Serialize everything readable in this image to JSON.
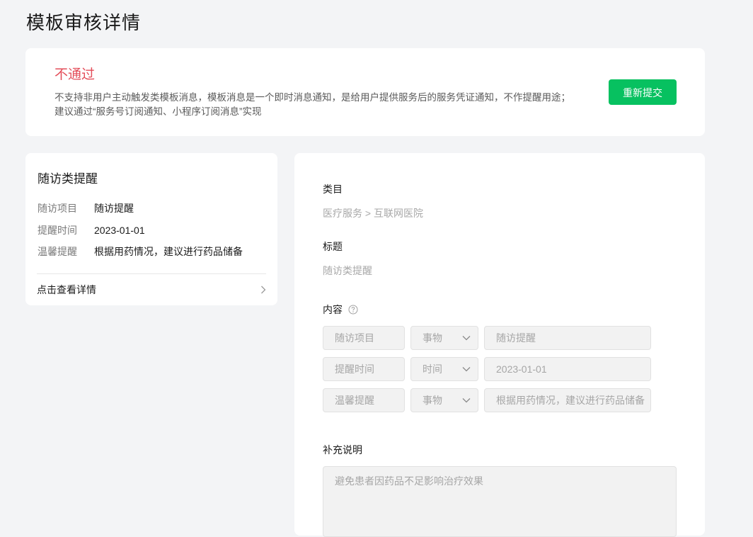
{
  "page": {
    "title": "模板审核详情"
  },
  "status": {
    "label": "不通过",
    "description": "不支持非用户主动触发类模板消息，模板消息是一个即时消息通知，是给用户提供服务后的服务凭证通知，不作提醒用途；建议通过“服务号订阅通知、小程序订阅消息”实现",
    "resubmit_label": "重新提交",
    "colors": {
      "reject": "#e34d59",
      "primary": "#07c160"
    }
  },
  "preview": {
    "title": "随访类提醒",
    "rows": [
      {
        "key": "随访项目",
        "value": "随访提醒"
      },
      {
        "key": "提醒时间",
        "value": "2023-01-01"
      },
      {
        "key": "温馨提醒",
        "value": "根据用药情况，建议进行药品储备"
      }
    ],
    "detail_link": "点击查看详情"
  },
  "form": {
    "category": {
      "label": "类目",
      "value": "医疗服务 > 互联网医院"
    },
    "title": {
      "label": "标题",
      "value": "随访类提醒"
    },
    "content": {
      "label": "内容",
      "rows": [
        {
          "key": "随访项目",
          "type": "事物",
          "value": "随访提醒"
        },
        {
          "key": "提醒时间",
          "type": "时间",
          "value": "2023-01-01"
        },
        {
          "key": "温馨提醒",
          "type": "事物",
          "value": "根据用药情况，建议进行药品储备"
        }
      ]
    },
    "note": {
      "label": "补充说明",
      "value": "避免患者因药品不足影响治疗效果"
    }
  },
  "icons": {
    "help": "help-circle-icon",
    "chevron": "chevron-right-icon",
    "caret": "chevron-down-icon"
  }
}
